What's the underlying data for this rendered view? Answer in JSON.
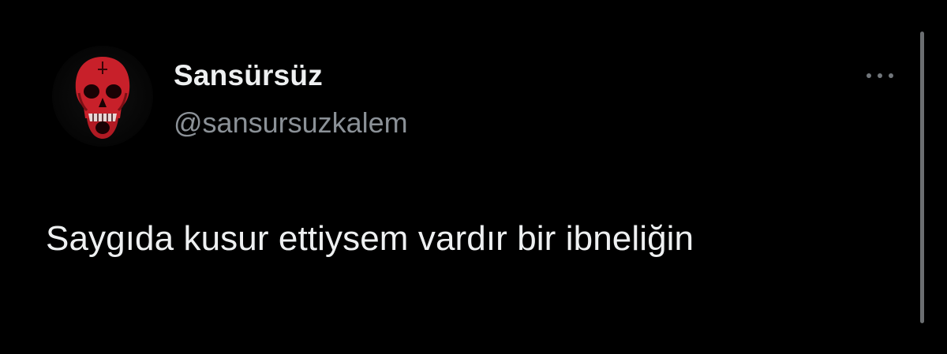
{
  "tweet": {
    "author": {
      "display_name": "Sansürsüz",
      "handle": "@sansursuzkalem",
      "avatar_icon": "red-skull-icon"
    },
    "more_icon": "more-options-icon",
    "text": "Saygıda kusur ettiysem vardır bir ibneliğin"
  },
  "colors": {
    "background": "#000000",
    "primary_text": "#eef0f1",
    "secondary_text": "#8b9197",
    "avatar_accent": "#c8202a"
  }
}
